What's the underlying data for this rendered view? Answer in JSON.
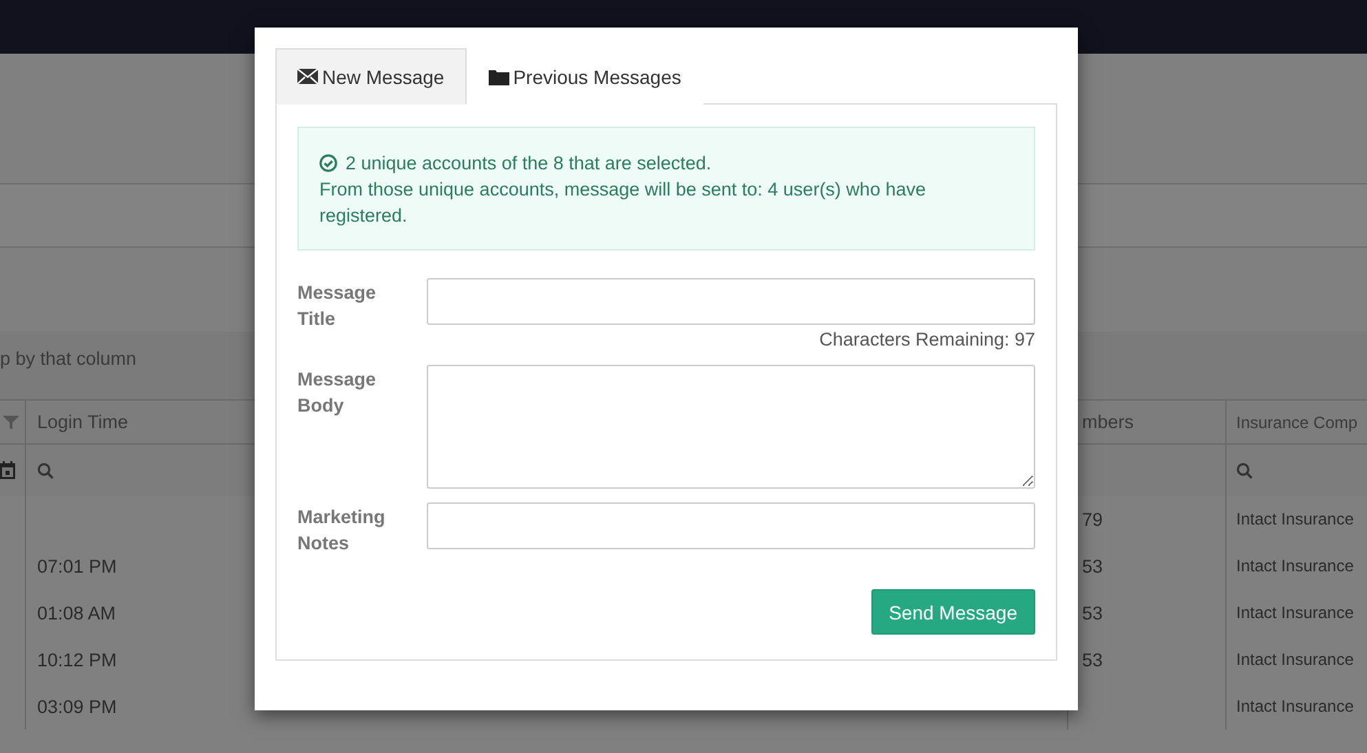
{
  "background": {
    "group_hint": "p by that column",
    "table": {
      "columns": [
        {
          "label": "Login Time",
          "search_filter": true
        },
        {
          "label": "mbers",
          "search_filter": false
        },
        {
          "label": "Insurance Comp",
          "search_filter": true
        }
      ],
      "rows": [
        {
          "numbers": "79",
          "insurance": "Intact Insurance"
        },
        {
          "login_time": "07:01 PM",
          "numbers": "53",
          "insurance": "Intact Insurance"
        },
        {
          "login_time": "01:08 AM",
          "numbers": "53",
          "insurance": "Intact Insurance"
        },
        {
          "login_time": "10:12 PM",
          "numbers": "53",
          "insurance": "Intact Insurance"
        },
        {
          "login_time": "03:09 PM",
          "insurance": "Intact Insurance"
        }
      ]
    }
  },
  "modal": {
    "tabs": [
      {
        "label": "New Message",
        "kind": "envelope",
        "selected": true
      },
      {
        "label": "Previous Messages",
        "kind": "folder",
        "selected": false
      }
    ],
    "alert": {
      "line_1": "2 unique accounts of the 8 that are selected.",
      "line_2": " From those unique accounts, message will be sent to: 4 user(s) who have registered."
    },
    "fields": [
      {
        "label": "Message Title",
        "kind": "input",
        "hint": "Characters Remaining: 97"
      },
      {
        "label": "Message Body",
        "kind": "textarea"
      },
      {
        "label": "Marketing Notes",
        "kind": "input"
      }
    ],
    "button": "Send Message"
  }
}
